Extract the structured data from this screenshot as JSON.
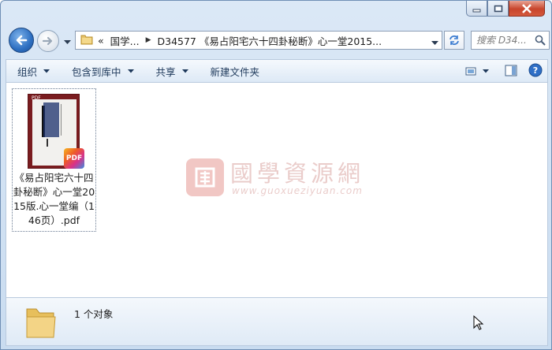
{
  "window": {
    "caption_buttons": [
      "minimize-icon",
      "maximize-icon",
      "close-icon"
    ]
  },
  "nav": {
    "back_icon": "back-arrow-icon",
    "forward_icon": "forward-arrow-icon",
    "history_icon": "chevron-down-icon"
  },
  "address": {
    "overflow": "«",
    "crumbs": [
      "国学...",
      "D34577 《易占阳宅六十四卦秘断》心一堂2015..."
    ]
  },
  "search": {
    "placeholder": "搜索 D34..."
  },
  "toolbar": {
    "organize": "组织",
    "include_library": "包含到库中",
    "share": "共享",
    "new_folder": "新建文件夹"
  },
  "file": {
    "name": "《易占阳宅六十四卦秘断》心一堂2015版.心一堂编（146页）.pdf",
    "badge": "PDF",
    "thumb_tag": "PDF"
  },
  "watermark": {
    "title": "國學資源網",
    "url": "www.guoxueziyuan.com"
  },
  "status": {
    "count": "1 个对象"
  },
  "colors": {
    "chrome": "#dbe8f6",
    "close": "#c8452c",
    "link_text": "#1e395b"
  }
}
